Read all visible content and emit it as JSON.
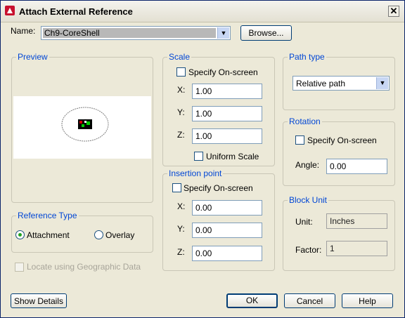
{
  "title": "Attach External Reference",
  "name": {
    "label": "Name:",
    "value": "Ch9-CoreShell",
    "browse": "Browse..."
  },
  "preview": {
    "legend": "Preview"
  },
  "scale": {
    "legend": "Scale",
    "specify": "Specify On-screen",
    "x_label": "X:",
    "x": "1.00",
    "y_label": "Y:",
    "y": "1.00",
    "z_label": "Z:",
    "z": "1.00",
    "uniform": "Uniform Scale"
  },
  "insertion": {
    "legend": "Insertion point",
    "specify": "Specify On-screen",
    "x_label": "X:",
    "x": "0.00",
    "y_label": "Y:",
    "y": "0.00",
    "z_label": "Z:",
    "z": "0.00"
  },
  "path_type": {
    "legend": "Path type",
    "value": "Relative path"
  },
  "rotation": {
    "legend": "Rotation",
    "specify": "Specify On-screen",
    "angle_label": "Angle:",
    "angle": "0.00"
  },
  "block_unit": {
    "legend": "Block Unit",
    "unit_label": "Unit:",
    "unit": "Inches",
    "factor_label": "Factor:",
    "factor": "1"
  },
  "reference_type": {
    "legend": "Reference Type",
    "attachment": "Attachment",
    "overlay": "Overlay",
    "selected": "Attachment"
  },
  "geo": "Locate using Geographic Data",
  "buttons": {
    "show_details": "Show Details",
    "ok": "OK",
    "cancel": "Cancel",
    "help": "Help"
  }
}
